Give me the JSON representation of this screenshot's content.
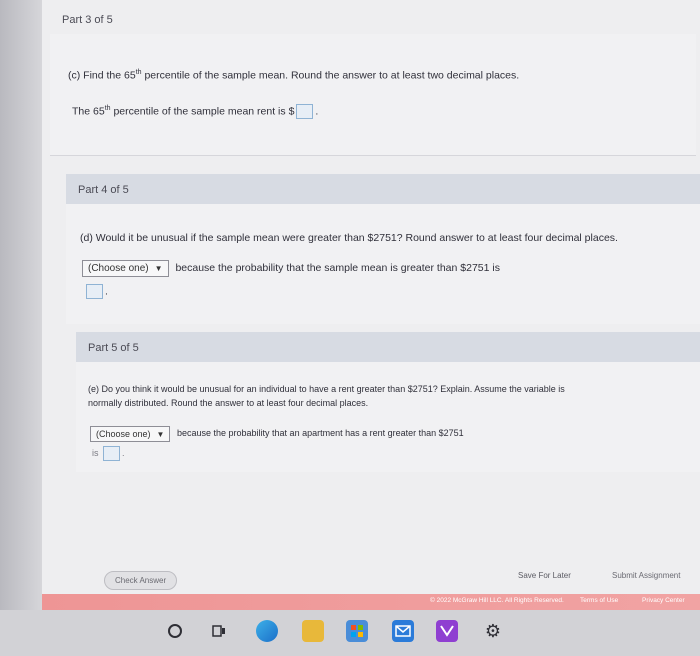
{
  "part3": {
    "header": "Part 3 of 5",
    "question": "(c) Find the 65",
    "question_sup": "th",
    "question_rest": " percentile of the sample mean. Round the answer to at least two decimal places.",
    "answer_prefix": "The 65",
    "answer_sup": "th",
    "answer_rest": " percentile of the sample mean rent is ",
    "currency": "$",
    "answer_suffix": "."
  },
  "part4": {
    "header": "Part 4 of 5",
    "question": "(d) Would it be unusual if the sample mean were greater than $2751? Round answer to at least four decimal places.",
    "select_label": "(Choose one)",
    "answer_text": "because the probability that the sample mean is greater than $2751 is",
    "answer_suffix": "."
  },
  "part5": {
    "header": "Part 5 of 5",
    "question_line1": "(e) Do you think it would be unusual for an individual to have a rent greater than $2751? Explain. Assume the variable is",
    "question_line2": "normally distributed. Round the answer to at least four decimal places.",
    "select_label": "(Choose one)",
    "answer_text": "because the probability that an apartment has a rent greater than $2751",
    "answer_is": "is",
    "answer_suffix": "."
  },
  "actions": {
    "check_answer": "Check Answer",
    "save_for_later": "Save For Later",
    "submit_assignment": "Submit Assignment"
  },
  "footer": {
    "copyright": "© 2022 McGraw Hill LLC. All Rights Reserved.",
    "terms": "Terms of Use",
    "privacy": "Privacy Center"
  },
  "taskbar": {
    "icons": [
      "search-circle-icon",
      "task-view-icon",
      "edge-icon",
      "file-explorer-icon",
      "store-icon",
      "mail-icon",
      "app-icon",
      "settings-icon"
    ]
  },
  "colors": {
    "header_bg": "#d7dbe3",
    "answer_box_border": "#8fb3d4",
    "footer_bar": "#ee9595"
  }
}
